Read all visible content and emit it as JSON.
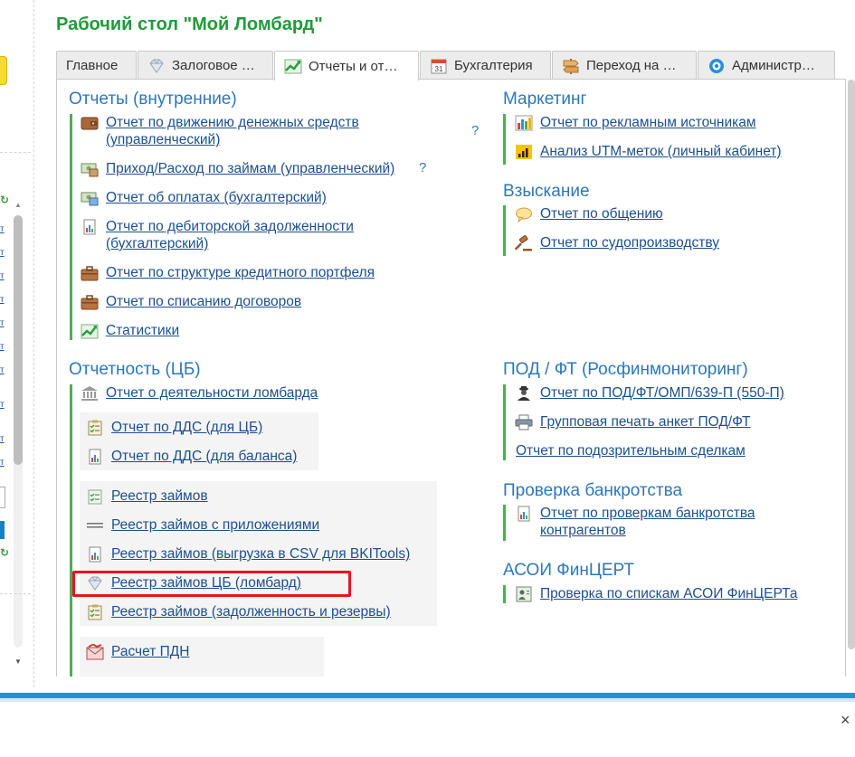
{
  "header": {
    "title": "Рабочий стол \"Мой Ломбард\""
  },
  "tabs": [
    {
      "label": "Главное",
      "icon": ""
    },
    {
      "label": "Залоговое …",
      "icon": "diamond-icon"
    },
    {
      "label": "Отчеты и от…",
      "icon": "chart-up-icon"
    },
    {
      "label": "Бухгалтерия",
      "icon": "calendar-icon"
    },
    {
      "label": "Переход на …",
      "icon": "signpost-icon"
    },
    {
      "label": "Администр…",
      "icon": "gear-icon"
    }
  ],
  "left_strip": {
    "link_glyph": "т",
    "green_glyph": "↻"
  },
  "groups": {
    "internal": {
      "title": "Отчеты (внутренние)",
      "help": "?",
      "items": [
        {
          "label": "Отчет по движению денежных средств (управленческий)",
          "label_line1": "Отчет по движению денежных средств",
          "label_line2": "(управленческий)",
          "icon": "wallet-icon"
        },
        {
          "label": "Приход/Расход по займам (управленческий)",
          "icon": "money-icon"
        },
        {
          "label": "Отчет об оплатах (бухгалтерский)",
          "icon": "money-icon"
        },
        {
          "label_line1": "Отчет по дебиторской задолженности",
          "label_line2": "(бухгалтерский)",
          "icon": "report-doc-icon"
        },
        {
          "label": "Отчет по структуре кредитного портфеля",
          "icon": "briefcase-icon"
        },
        {
          "label": "Отчет по списанию договоров",
          "icon": "briefcase-icon"
        },
        {
          "label": "Статистики",
          "icon": "chart-up-icon"
        }
      ]
    },
    "cb": {
      "title": "Отчетность (ЦБ)",
      "items": [
        {
          "label": "Отчет о деятельности ломбарда",
          "icon": "bank-icon"
        },
        {
          "label": "Отчет по ДДС (для ЦБ)",
          "icon": "checklist-icon"
        },
        {
          "label": "Отчет по ДДС (для баланса)",
          "icon": "report-doc-icon"
        },
        {
          "label": "Реестр займов",
          "icon": "checklist-icon"
        },
        {
          "label": "Реестр займов с приложениями",
          "icon": "lines-icon"
        },
        {
          "label": "Реестр займов (выгрузка в CSV для BKITools)",
          "icon": "report-doc-icon"
        },
        {
          "label": "Реестр займов ЦБ (ломбард)",
          "icon": "diamond-icon"
        },
        {
          "label": "Реестр займов (задолженность и резервы)",
          "icon": "checklist-icon"
        },
        {
          "label": "Расчет ПДН",
          "icon": "mail-chart-icon"
        }
      ]
    },
    "marketing": {
      "title": "Маркетинг",
      "items": [
        {
          "label": "Отчет по рекламным источникам",
          "icon": "bar-chart-icon"
        },
        {
          "label": "Анализ UTM-меток (личный кабинет)",
          "icon": "signal-icon"
        }
      ]
    },
    "collection": {
      "title": "Взыскание",
      "items": [
        {
          "label": "Отчет по общению",
          "icon": "speech-bubble-icon"
        },
        {
          "label": "Отчет по судопроизводству",
          "icon": "gavel-icon"
        }
      ]
    },
    "pod": {
      "title": "ПОД / ФТ (Росфинмониторинг)",
      "items": [
        {
          "label": "Отчет по ПОД/ФТ/ОМП/639-П (550-П)",
          "icon": "spy-icon"
        },
        {
          "label": "Групповая печать анкет ПОД/ФТ",
          "icon": "printer-icon"
        },
        {
          "label": "Отчет по подозрительным сделкам",
          "icon": ""
        }
      ]
    },
    "bankruptcy": {
      "title": "Проверка банкротства",
      "items": [
        {
          "label_line1": "Отчет по проверкам банкротства",
          "label_line2": "контрагентов",
          "icon": "report-doc-icon"
        }
      ]
    },
    "asoi": {
      "title": "АСОИ ФинЦЕРТ",
      "items": [
        {
          "label": "Проверка по спискам АСОИ ФинЦЕРТа",
          "icon": "id-card-icon"
        }
      ]
    }
  },
  "bottom": {
    "close_glyph": "×"
  }
}
